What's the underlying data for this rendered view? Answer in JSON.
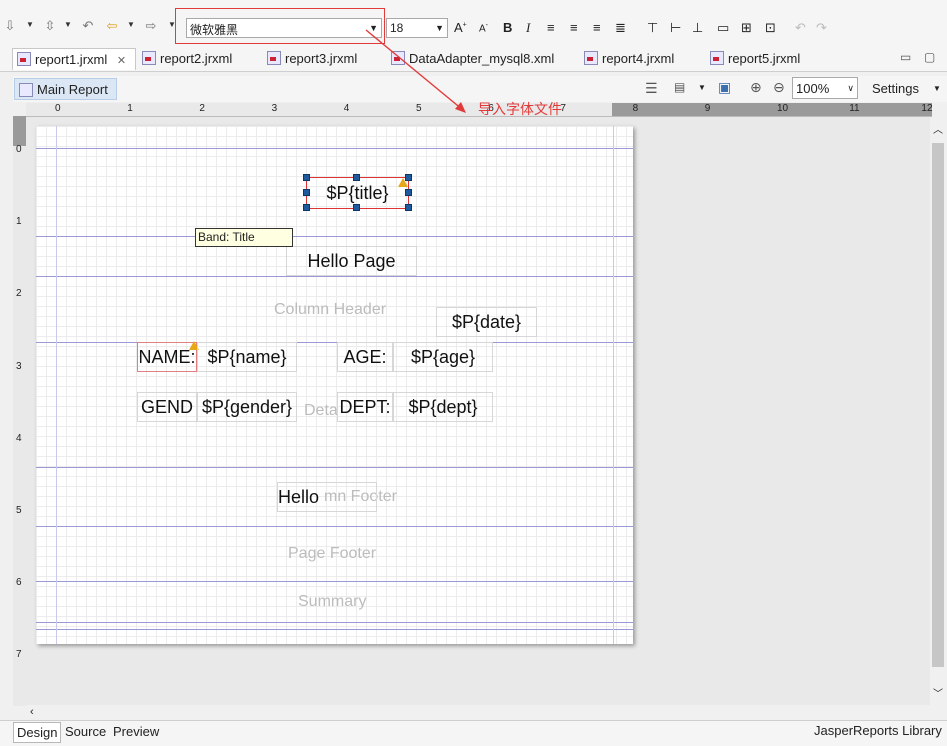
{
  "toolbar": {
    "font_name": "微软雅黑",
    "font_size": "18",
    "bold": "B",
    "italic": "I"
  },
  "tabs": [
    {
      "label": "report1.jrxml"
    },
    {
      "label": "report2.jrxml"
    },
    {
      "label": "report3.jrxml"
    },
    {
      "label": "DataAdapter_mysql8.xml"
    },
    {
      "label": "report4.jrxml"
    },
    {
      "label": "report5.jrxml"
    }
  ],
  "editor": {
    "main_report": "Main Report",
    "zoom": "100%",
    "settings": "Settings"
  },
  "ruler": {
    "h": [
      "0",
      "1",
      "2",
      "3",
      "4",
      "5",
      "6",
      "7",
      "8",
      "9",
      "10",
      "11",
      "12"
    ],
    "v": [
      "0",
      "1",
      "2",
      "3",
      "4",
      "5",
      "6",
      "7"
    ]
  },
  "annotation": "导入字体文件",
  "tooltip": "Band: Title",
  "bands": {
    "title_field": "$P{title}",
    "page_header_text": "Hello Page",
    "column_header_label": "Column Header",
    "date_field": "$P{date}",
    "name_label": "NAME:",
    "name_field": "$P{name}",
    "age_label": "AGE:",
    "age_field": "$P{age}",
    "gender_label": "GEND",
    "gender_field": "$P{gender}",
    "detail_label": "Deta",
    "dept_label": "DEPT:",
    "dept_field": "$P{dept}",
    "hello_text": "Hello",
    "column_footer_label": "mn Footer",
    "page_footer_label": "Page Footer",
    "summary_label": "Summary"
  },
  "bottom_tabs": [
    "Design",
    "Source",
    "Preview"
  ],
  "library_label": "JasperReports Library",
  "colors": {
    "annotation": "#e23a3a",
    "selection_handle": "#1f5a9e",
    "band_line": "#9a9ad6"
  }
}
